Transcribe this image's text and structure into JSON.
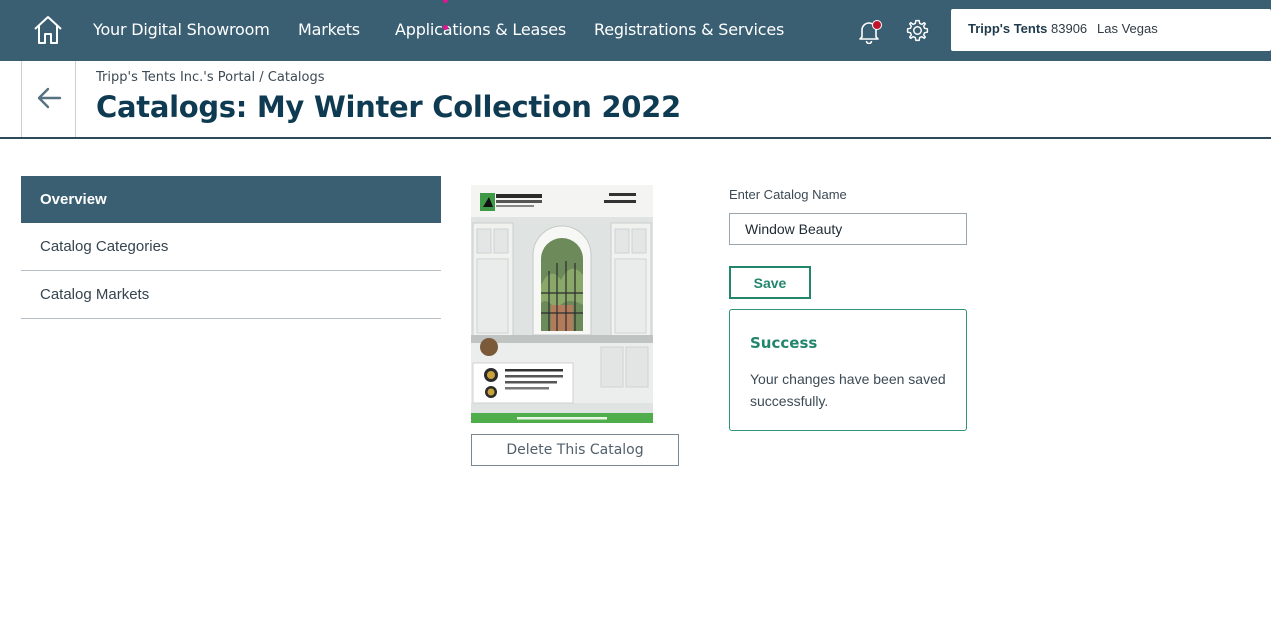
{
  "nav": {
    "items": [
      "Your Digital Showroom",
      "Markets",
      "Applications & Leases",
      "Registrations & Services"
    ],
    "account": {
      "name": "Tripp's Tents",
      "id": "83906",
      "city": "Las Vegas"
    },
    "colors": {
      "bar": "#3a5f73",
      "notification_dot": "#c0142a"
    }
  },
  "header": {
    "breadcrumb": {
      "portal": "Tripp's Tents Inc.'s Portal",
      "separator": "/",
      "current": "Catalogs"
    },
    "title": "Catalogs: My Winter Collection 2022"
  },
  "sidebar": {
    "items": [
      {
        "label": "Overview",
        "active": true
      },
      {
        "label": "Catalog Categories",
        "active": false
      },
      {
        "label": "Catalog Markets",
        "active": false
      }
    ]
  },
  "catalog": {
    "cover": {
      "brand": "RENEWAL by ANDERSEN",
      "heading_line1": "WINDOWS",
      "heading_line2": "PATIO DOORS",
      "footer": "The Better Way to a Better Window"
    },
    "delete_label": "Delete This Catalog"
  },
  "form": {
    "label": "Enter Catalog Name",
    "value": "Window Beauty",
    "save_label": "Save"
  },
  "alert": {
    "title": "Success",
    "message": "Your changes have been saved successfully.",
    "color": "#23866c"
  }
}
